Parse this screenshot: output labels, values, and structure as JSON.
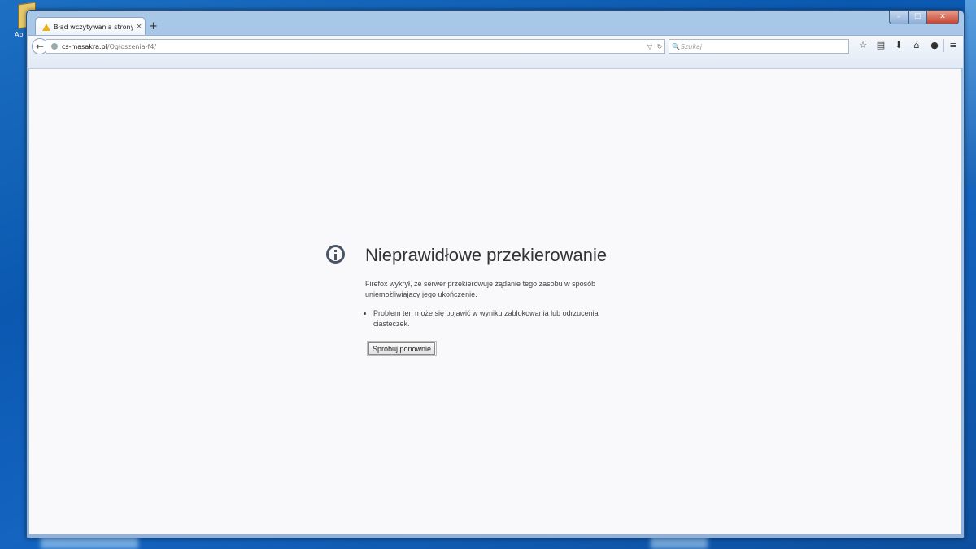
{
  "desktop": {
    "icon_label": "Ap"
  },
  "window": {
    "close_label": "✕",
    "min_label": "–",
    "max_label": "☐"
  },
  "tab": {
    "title": "Błąd wczytywania strony",
    "close": "×",
    "new_tab": "+"
  },
  "nav": {
    "back": "←",
    "url_host": "cs-masakra.pl",
    "url_path": "/Ogłoszenia-f4/",
    "dropdown": "▽",
    "reload": "↻",
    "search_placeholder": "Szukaj",
    "search_glyph": "🔍",
    "toolbar": {
      "bookmark": "☆",
      "reading_list": "▤",
      "downloads": "⬇",
      "home": "⌂",
      "chat": "●",
      "menu": "≡"
    }
  },
  "error": {
    "title": "Nieprawidłowe przekierowanie",
    "description": "Firefox wykrył, że serwer przekierowuje żądanie tego zasobu w sposób uniemożliwiający jego ukończenie.",
    "hints": [
      "Problem ten może się pojawić w wyniku zablokowania lub odrzucenia ciasteczek."
    ],
    "retry_label": "Spróbuj ponownie"
  }
}
